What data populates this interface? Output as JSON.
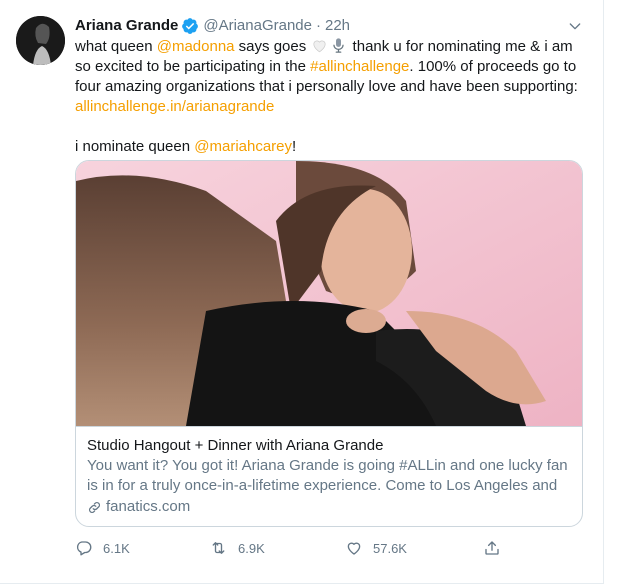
{
  "tweet": {
    "author_name": "Ariana Grande",
    "author_handle": "@ArianaGrande",
    "separator": "·",
    "timestamp": "22h",
    "verified": true,
    "text": {
      "seg1": "what queen ",
      "mention1": "@madonna",
      "seg2": " says goes ",
      "seg3": " thank u for nominating me & i am so excited to be participating in the ",
      "hashtag": "#allinchallenge",
      "seg4": ". 100% of proceeds go to four amazing organizations that i personally love and have been supporting: ",
      "url": "allinchallenge.in/arianagrande",
      "line2_pre": "i nominate queen ",
      "mention2": "@mariahcarey",
      "line2_post": "!"
    },
    "emojis": [
      "white-heart-icon",
      "microphone-icon"
    ]
  },
  "card": {
    "title": "Studio Hangout + Dinner with Ariana Grande",
    "description": "You want it? You got it! Ariana Grande is going #ALLin and one lucky fan is in for a truly once-in-a-lifetime experience. Come to Los Angeles and ...",
    "domain": "fanatics.com"
  },
  "actions": {
    "replies": "6.1K",
    "retweets": "6.9K",
    "likes": "57.6K"
  },
  "colors": {
    "link": "#f59f00",
    "verified": "#1da1f2",
    "secondary_text": "#657786",
    "card_background": "#f4c6d3"
  }
}
